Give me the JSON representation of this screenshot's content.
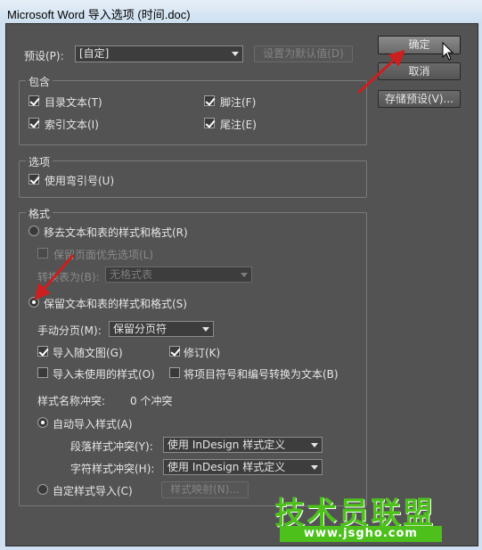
{
  "window": {
    "title": "Microsoft Word 导入选项 (时间.doc)"
  },
  "preset": {
    "label": "预设(P):",
    "value": "[自定]",
    "set_default_label": "设置为默认值(D)"
  },
  "buttons": {
    "ok": "确定",
    "cancel": "取消",
    "save_preset": "存储预设(V)..."
  },
  "include": {
    "title": "包含",
    "toc": "目录文本(T)",
    "footnotes": "脚注(F)",
    "index": "索引文本(I)",
    "endnotes": "尾注(E)"
  },
  "options": {
    "title": "选项",
    "curly_quotes": "使用弯引号(U)"
  },
  "format": {
    "title": "格式",
    "remove": "移去文本和表的样式和格式(R)",
    "preserve_local": "保留页面优先选项(L)",
    "convert_tables_label": "转换表为(B):",
    "convert_tables_value": "无格式表",
    "preserve": "保留文本和表的样式和格式(S)",
    "manual_break_label": "手动分页(M):",
    "manual_break_value": "保留分页符",
    "import_graphics": "导入随文图(G)",
    "track_changes": "修订(K)",
    "import_unused": "导入未使用的样式(O)",
    "convert_bullets": "将项目符号和编号转换为文本(B)",
    "style_conflicts_label": "样式名称冲突:",
    "style_conflicts_value": "0 个冲突",
    "auto_import": "自动导入样式(A)",
    "para_conflict_label": "段落样式冲突(Y):",
    "para_conflict_value": "使用 InDesign 样式定义",
    "char_conflict_label": "字符样式冲突(H):",
    "char_conflict_value": "使用 InDesign 样式定义",
    "custom_import": "自定样式导入(C)",
    "style_mapping": "样式映射(N)..."
  },
  "watermark": {
    "text": "技术员联盟",
    "url": "www.jsgho.com"
  },
  "colors": {
    "dialog_bg": "#535353",
    "arrow": "#cc1f1f",
    "watermark": "#4dc01c"
  }
}
